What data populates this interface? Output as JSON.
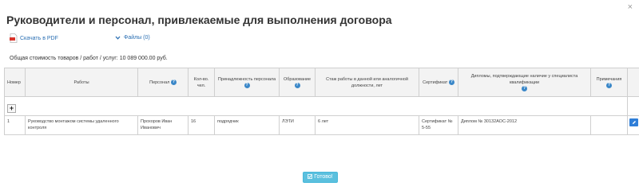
{
  "dialog": {
    "close_glyph": "×",
    "title": "Руководители и персонал, привлекаемые для выполнения договора"
  },
  "toolbar": {
    "pdf_label": "Скачать в PDF",
    "files_label": "Файлы (0)"
  },
  "total_cost": "Общая стоимость товаров / работ / услуг: 10 089 000.00 руб.",
  "table": {
    "headers": {
      "number": "Номер",
      "works": "Работы",
      "personnel": "Персонал",
      "count": "Кол-во. чел.",
      "affiliation": "Принадлежность персонала",
      "education": "Образование",
      "experience": "Стаж работы в данной или аналогичной должности, лет",
      "certificate": "Сертификат",
      "diplomas": "Дипломы, подтверждающие наличие у специалиста квалификации",
      "notes": "Примечания"
    },
    "add_label": "+",
    "rows": [
      {
        "number": "1",
        "works": "Руководство монтажом системы удаленного контроля",
        "personnel": "Прохоров Иван Иванович",
        "count": "16",
        "affiliation": "подрядчик",
        "education": "ЛЭТИ",
        "experience": "6 лет",
        "certificate": "Сертификат № 5-55",
        "diplomas": "Диплом № 30132АОС-2012",
        "notes": ""
      }
    ]
  },
  "done_label": "Готово!"
}
